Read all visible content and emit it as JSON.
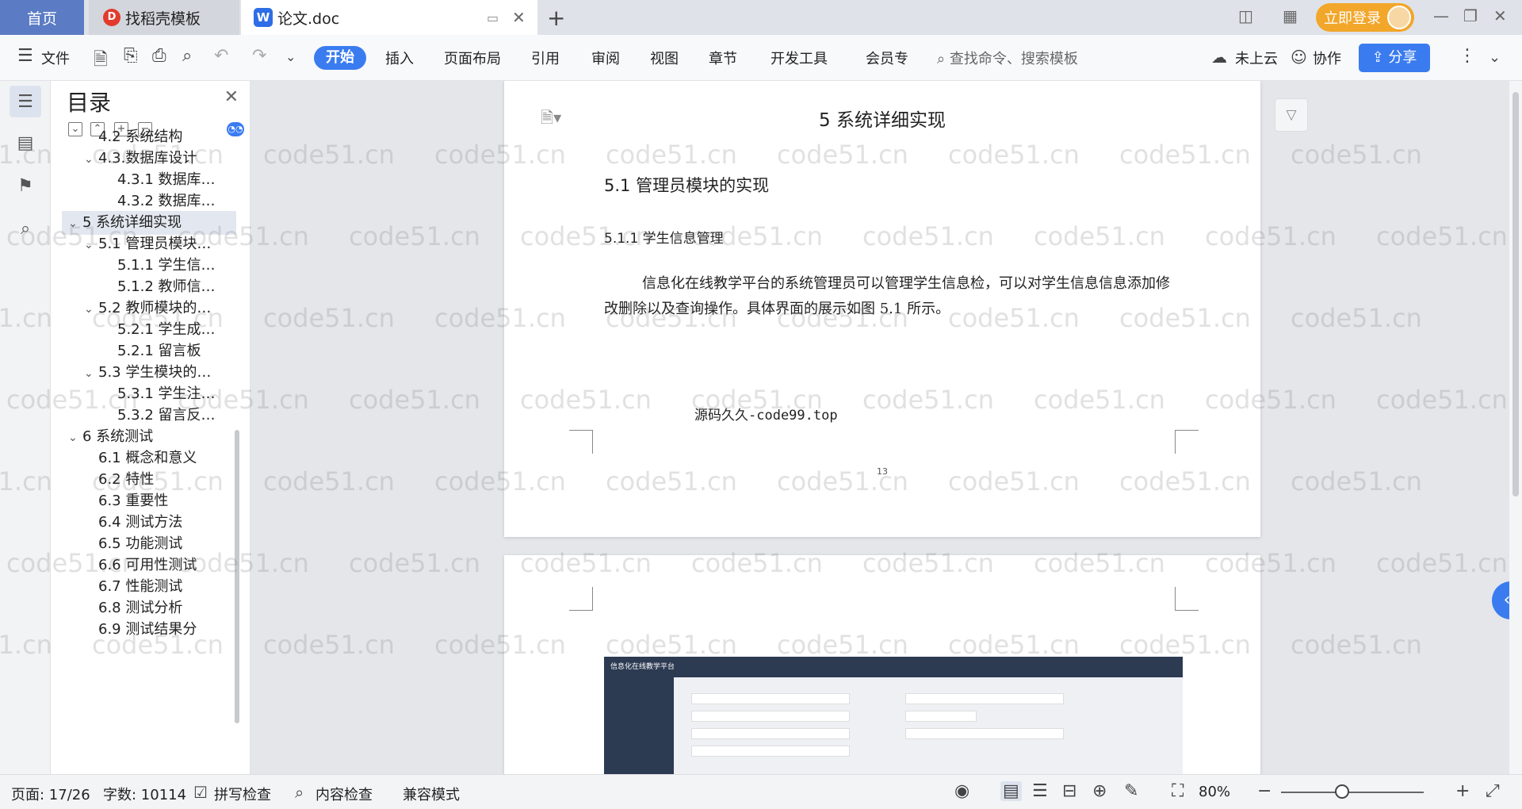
{
  "tabs": {
    "home": "首页",
    "daoke": "找稻壳模板",
    "doc": "论文.doc"
  },
  "login": "立即登录",
  "toolbar": {
    "file": "文件",
    "tabs": [
      "开始",
      "插入",
      "页面布局",
      "引用",
      "审阅",
      "视图",
      "章节",
      "开发工具",
      "会员专"
    ],
    "search_placeholder": "查找命令、搜索模板",
    "cloud": "未上云",
    "collab": "协作",
    "share": "分享"
  },
  "toc": {
    "title": "目录",
    "items": [
      {
        "label": "4.2 系统结构",
        "level": 2,
        "chev": ""
      },
      {
        "label": "4.3.数据库设计",
        "level": 2,
        "chev": "⌄"
      },
      {
        "label": "4.3.1 数据库…",
        "level": 3,
        "chev": ""
      },
      {
        "label": "4.3.2 数据库…",
        "level": 3,
        "chev": ""
      },
      {
        "label": "5 系统详细实现",
        "level": 1,
        "chev": "⌄"
      },
      {
        "label": "5.1 管理员模块…",
        "level": 2,
        "chev": "⌄"
      },
      {
        "label": "5.1.1 学生信…",
        "level": 3,
        "chev": ""
      },
      {
        "label": "5.1.2 教师信…",
        "level": 3,
        "chev": ""
      },
      {
        "label": "5.2 教师模块的…",
        "level": 2,
        "chev": "⌄"
      },
      {
        "label": "5.2.1 学生成…",
        "level": 3,
        "chev": ""
      },
      {
        "label": "5.2.1 留言板",
        "level": 3,
        "chev": ""
      },
      {
        "label": "5.3 学生模块的…",
        "level": 2,
        "chev": "⌄"
      },
      {
        "label": "5.3.1 学生注…",
        "level": 3,
        "chev": ""
      },
      {
        "label": "5.3.2 留言反…",
        "level": 3,
        "chev": ""
      },
      {
        "label": "6 系统测试",
        "level": 1,
        "chev": "⌄"
      },
      {
        "label": "6.1 概念和意义",
        "level": 2,
        "chev": ""
      },
      {
        "label": "6.2 特性",
        "level": 2,
        "chev": ""
      },
      {
        "label": "6.3 重要性",
        "level": 2,
        "chev": ""
      },
      {
        "label": "6.4 测试方法",
        "level": 2,
        "chev": ""
      },
      {
        "label": "6.5 功能测试",
        "level": 2,
        "chev": ""
      },
      {
        "label": "6.6 可用性测试",
        "level": 2,
        "chev": ""
      },
      {
        "label": "6.7 性能测试",
        "level": 2,
        "chev": ""
      },
      {
        "label": "6.8 测试分析",
        "level": 2,
        "chev": ""
      },
      {
        "label": "6.9 测试结果分",
        "level": 2,
        "chev": ""
      }
    ]
  },
  "doc": {
    "h1": "5 系统详细实现",
    "h2": "5.1 管理员模块的实现",
    "h3": "5.1.1 学生信息管理",
    "para": "信息化在线教学平台的系统管理员可以管理学生信息检，可以对学生信息信息添加修改删除以及查询操作。具体界面的展示如图 5.1 所示。",
    "source_note": "源码久久-code99.top",
    "page_number": "13",
    "shot_title": "信息化在线教学平台"
  },
  "watermark": "code51.cn",
  "status": {
    "page": "页面: 17/26",
    "words": "字数: 10114",
    "spell": "拼写检查",
    "content_check": "内容检查",
    "compat": "兼容模式",
    "zoom": "80%"
  },
  "colors": {
    "accent": "#3a7cf0",
    "login": "#f2a62a",
    "home_tab": "#5b7cc4"
  }
}
